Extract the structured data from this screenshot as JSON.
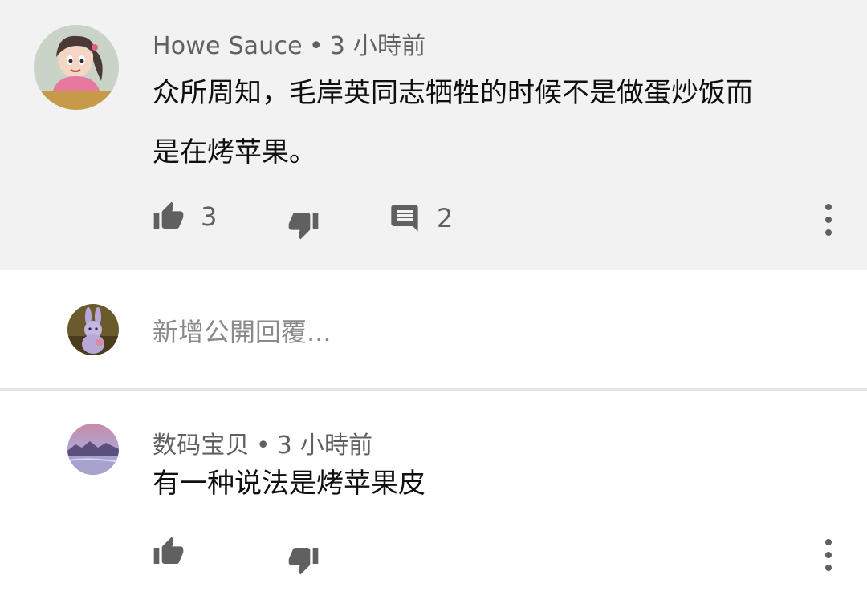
{
  "comments": [
    {
      "author": "Howe Sauce",
      "separator": "•",
      "time": "3 小時前",
      "text_lines": [
        "众所周知，毛岸英同志牺牲的时候不是做蛋炒饭而",
        "是在烤苹果。"
      ],
      "like_count": "3",
      "reply_count": "2",
      "like_icon": "thumbs-up-icon",
      "dislike_icon": "thumbs-down-icon",
      "reply_icon": "comment-icon",
      "more_icon": "more-vert-icon"
    },
    {
      "author": "数码宝贝",
      "separator": "•",
      "time": "3 小時前",
      "text_lines": [
        "有一种说法是烤苹果皮"
      ],
      "like_icon": "thumbs-up-icon",
      "dislike_icon": "thumbs-down-icon",
      "more_icon": "more-vert-icon"
    }
  ],
  "reply_box": {
    "placeholder": "新增公開回覆..."
  },
  "colors": {
    "highlight_background": "#f2f2f2",
    "secondary_text": "#606060",
    "icon": "#606060"
  }
}
